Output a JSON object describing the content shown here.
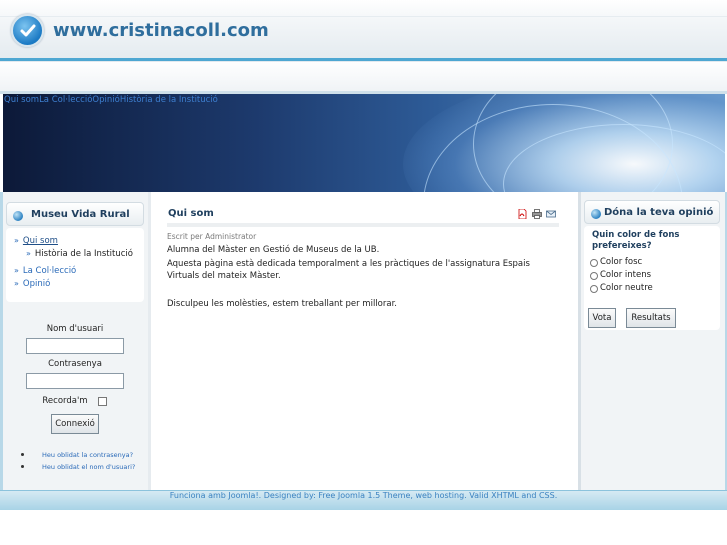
{
  "header": {
    "site_title": "www.cristinacoll.com"
  },
  "topmenu": {
    "items": [
      "Qui som",
      "La Col·lecció",
      "Opinió",
      "Història de la Institució"
    ]
  },
  "left_menu": {
    "title": "Museu Vida Rural",
    "items": [
      {
        "label": "Qui som"
      },
      {
        "label": "Història de la Institució"
      },
      {
        "label": "La Col·lecció"
      },
      {
        "label": "Opinió"
      }
    ]
  },
  "login": {
    "username_label": "Nom d'usuari",
    "password_label": "Contrasenya",
    "remember_label": "Recorda'm",
    "submit_label": "Connexió",
    "forgot_password": "Heu oblidat la contrasenya?",
    "forgot_username": "Heu oblidat el nom d'usuari?"
  },
  "article": {
    "title": "Qui som",
    "author": "Escrit per Administrator",
    "paragraphs": [
      "Alumna del Màster en Gestió de Museus de la UB.",
      "Aquesta pàgina està dedicada temporalment a les pràctiques de l'assignatura Espais Virtuals del mateix Màster.",
      "Disculpeu les molèsties, estem treballant per millorar."
    ],
    "icons": [
      "pdf-icon",
      "print-icon",
      "email-icon"
    ]
  },
  "poll": {
    "title": "Dóna la teva opinió",
    "question": "Quin color de fons prefereixes?",
    "options": [
      "Color fosc",
      "Color intens",
      "Color neutre"
    ],
    "vote_label": "Vota",
    "results_label": "Resultats"
  },
  "footer": {
    "text": "Funciona amb Joomla!. Designed by: Free Joomla 1.5 Theme, web hosting. Valid XHTML and CSS."
  },
  "colors": {
    "accent": "#2f6e9d",
    "link": "#2a6ab8",
    "footer_bg": "#a8d3e6"
  }
}
